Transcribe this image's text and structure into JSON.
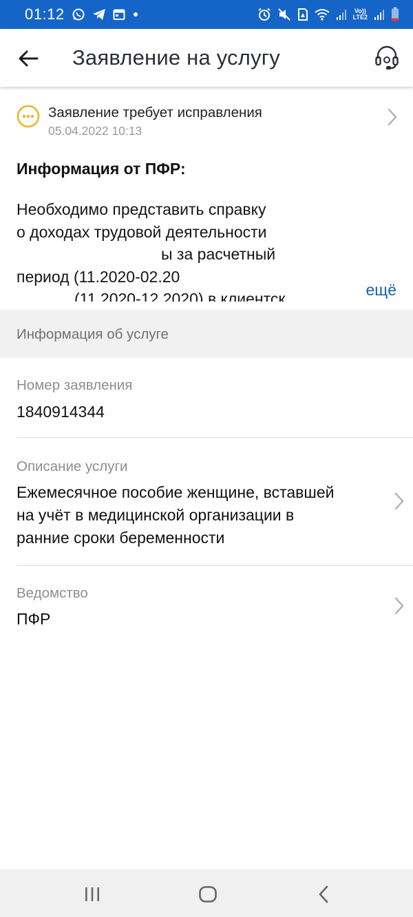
{
  "status_bar": {
    "time": "01:12",
    "lte_label_top": "Vo))",
    "lte_label_bottom": "LTE2",
    "icon_color": "#ffffff",
    "background": "#1565c8"
  },
  "app_bar": {
    "title": "Заявление на услугу",
    "back_icon": "arrow-left-icon",
    "support_icon": "headset-icon"
  },
  "application_status": {
    "icon": "ellipsis-circle-icon",
    "icon_color": "#f0b429",
    "title": "Заявление требует исправления",
    "date": "05.04.2022 10:13"
  },
  "pfr_info": {
    "heading": "Информация от ПФР:",
    "lines": [
      "Необходимо представить справку",
      "о доходах трудовой деятельности",
      "ы за расчетный",
      "период (11.2020-02.20",
      "(11.2020-12.2020) в клиентск"
    ],
    "more_label": "ещё",
    "link_color": "#1463a8"
  },
  "service_section": {
    "header": "Информация об услуге"
  },
  "fields": {
    "application_number": {
      "label": "Номер заявления",
      "value": "1840914344"
    },
    "service_description": {
      "label": "Описание услуги",
      "value_lines": [
        "Ежемесячное пособие женщине, вставшей",
        "на учёт в медицинской организации в",
        "ранние сроки беременности"
      ]
    },
    "department": {
      "label": "Ведомство",
      "value": "ПФР"
    }
  },
  "nav_bar": {
    "recents_icon": "recents-icon",
    "home_icon": "home-icon",
    "back_icon": "nav-back-icon"
  }
}
